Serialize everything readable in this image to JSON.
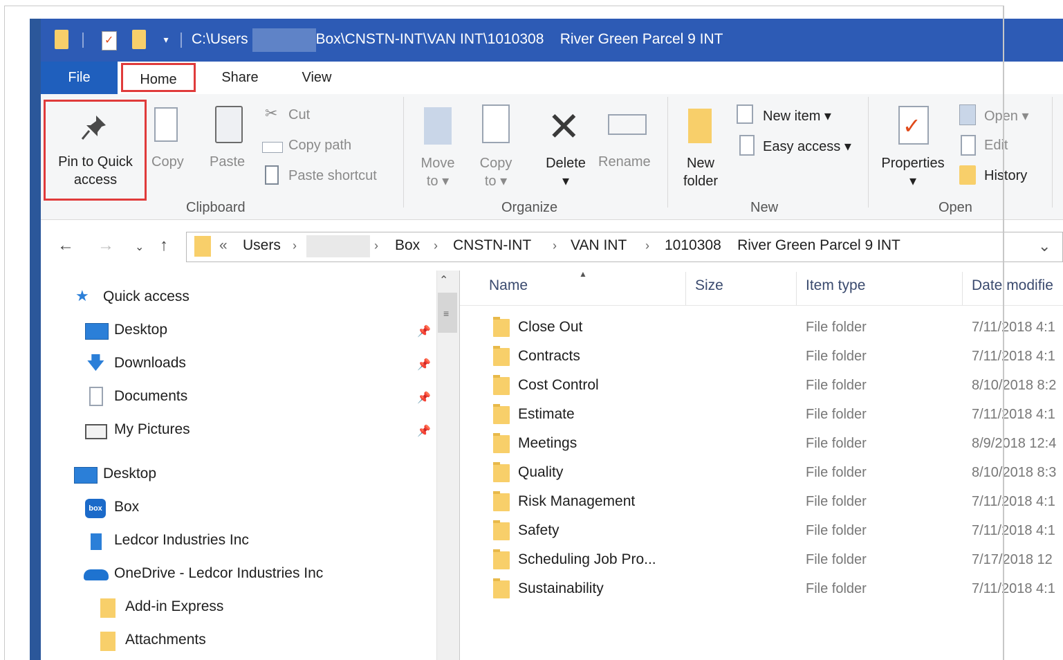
{
  "titlebar": {
    "path_prefix": "C:\\Users",
    "path_rest": "\\Box\\CNSTN-INT\\VAN INT\\1010308    River Green Parcel 9 INT"
  },
  "tabs": {
    "file": "File",
    "home": "Home",
    "share": "Share",
    "view": "View"
  },
  "ribbon": {
    "clipboard": {
      "pin_line1": "Pin to Quick",
      "pin_line2": "access",
      "copy": "Copy",
      "paste": "Paste",
      "cut": "Cut",
      "copy_path": "Copy path",
      "paste_shortcut": "Paste shortcut",
      "group": "Clipboard"
    },
    "organize": {
      "move_line1": "Move",
      "move_line2": "to",
      "copy_line1": "Copy",
      "copy_line2": "to",
      "delete": "Delete",
      "rename": "Rename",
      "group": "Organize"
    },
    "new": {
      "folder_line1": "New",
      "folder_line2": "folder",
      "new_item": "New item",
      "easy_access": "Easy access",
      "group": "New"
    },
    "open": {
      "properties": "Properties",
      "open": "Open",
      "edit": "Edit",
      "history": "History",
      "group": "Open"
    }
  },
  "address": {
    "overflow": "«",
    "crumbs": [
      "Users",
      "Box",
      "CNSTN-INT",
      "VAN INT",
      "1010308    River Green Parcel 9 INT"
    ]
  },
  "nav": {
    "quick_access": "Quick access",
    "pinned": [
      "Desktop",
      "Downloads",
      "Documents",
      "My Pictures"
    ],
    "desktop": "Desktop",
    "box": "Box",
    "ledcor": "Ledcor Industries Inc",
    "onedrive": "OneDrive - Ledcor Industries Inc",
    "subfolders": [
      "Add-in Express",
      "Attachments"
    ]
  },
  "columns": {
    "name": "Name",
    "size": "Size",
    "type": "Item type",
    "date": "Date modifie"
  },
  "files": [
    {
      "name": "Close Out",
      "type": "File folder",
      "date": "7/11/2018 4:1"
    },
    {
      "name": "Contracts",
      "type": "File folder",
      "date": "7/11/2018 4:1"
    },
    {
      "name": "Cost Control",
      "type": "File folder",
      "date": "8/10/2018 8:2"
    },
    {
      "name": "Estimate",
      "type": "File folder",
      "date": "7/11/2018 4:1"
    },
    {
      "name": "Meetings",
      "type": "File folder",
      "date": "8/9/2018 12:4"
    },
    {
      "name": "Quality",
      "type": "File folder",
      "date": "8/10/2018 8:3"
    },
    {
      "name": "Risk Management",
      "type": "File folder",
      "date": "7/11/2018 4:1"
    },
    {
      "name": "Safety",
      "type": "File folder",
      "date": "7/11/2018 4:1"
    },
    {
      "name": "Scheduling Job Pro...",
      "type": "File folder",
      "date": "7/17/2018 12"
    },
    {
      "name": "Sustainability",
      "type": "File folder",
      "date": "7/11/2018 4:1"
    }
  ],
  "colors": {
    "titlebar": "#2d5bb5",
    "file_tab": "#1f5fbd",
    "highlight": "#e03b3b",
    "folder": "#f8cf6a"
  }
}
